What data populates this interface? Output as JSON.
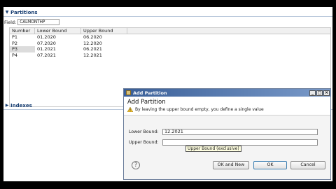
{
  "partitions": {
    "section_title": "Partitions",
    "field_label": "Field:",
    "field_value": "CALMONTHP",
    "columns": [
      "Number",
      "Lower Bound",
      "Upper Bound"
    ],
    "rows": [
      {
        "number": "P1",
        "lower": "01.2020",
        "upper": "06.2020"
      },
      {
        "number": "P2",
        "lower": "07.2020",
        "upper": "12.2020"
      },
      {
        "number": "P3",
        "lower": "01.2021",
        "upper": "06.2021"
      },
      {
        "number": "P4",
        "lower": "07.2021",
        "upper": "12.2021"
      }
    ],
    "selected_row": "P3"
  },
  "indexes": {
    "section_title": "Indexes"
  },
  "dialog": {
    "window_title": "Add Partition",
    "heading": "Add Partition",
    "message": "By leaving the upper bound empty, you define a single value",
    "lower_bound_label": "Lower Bound:",
    "lower_bound_value": "12.2021",
    "upper_bound_label": "Upper Bound:",
    "upper_bound_value": "",
    "tooltip": "Upper Bound (exclusive)",
    "buttons": {
      "ok_and_new": "OK and New",
      "ok": "OK",
      "cancel": "Cancel"
    },
    "window_buttons": {
      "minimize": "_",
      "maximize": "□",
      "close": "×"
    },
    "help_symbol": "?"
  },
  "colors": {
    "section_title": "#173e72",
    "titlebar_start": "#3a5f98",
    "titlebar_end": "#7a9ac9",
    "tooltip_bg": "#ffffe1"
  }
}
